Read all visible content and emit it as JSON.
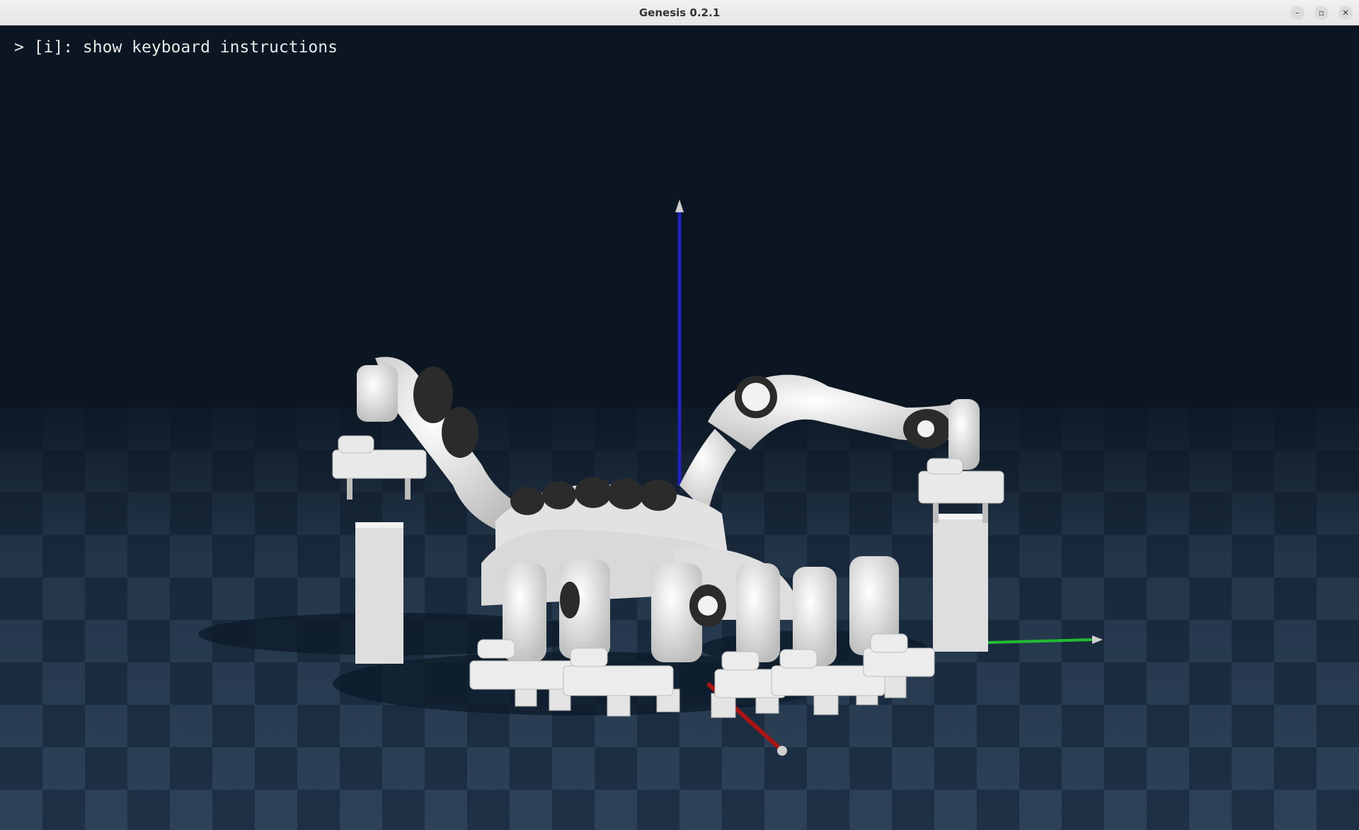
{
  "window": {
    "title": "Genesis 0.2.1",
    "controls": {
      "minimize_glyph": "–",
      "maximize_glyph": "▫",
      "close_glyph": "✕"
    }
  },
  "viewport": {
    "hint_text": "> [i]: show keyboard instructions",
    "colors": {
      "sky": "#0b1622",
      "floor_dark": "#1e3045",
      "floor_light": "#2d4259",
      "axis_z": "#2222bb",
      "axis_y": "#22bb33",
      "axis_x": "#aa1515",
      "robot_white": "#e9e9e9",
      "robot_dark": "#2b2b2b"
    },
    "icons": [
      "axis-gizmo",
      "robot-arm",
      "cube"
    ]
  }
}
